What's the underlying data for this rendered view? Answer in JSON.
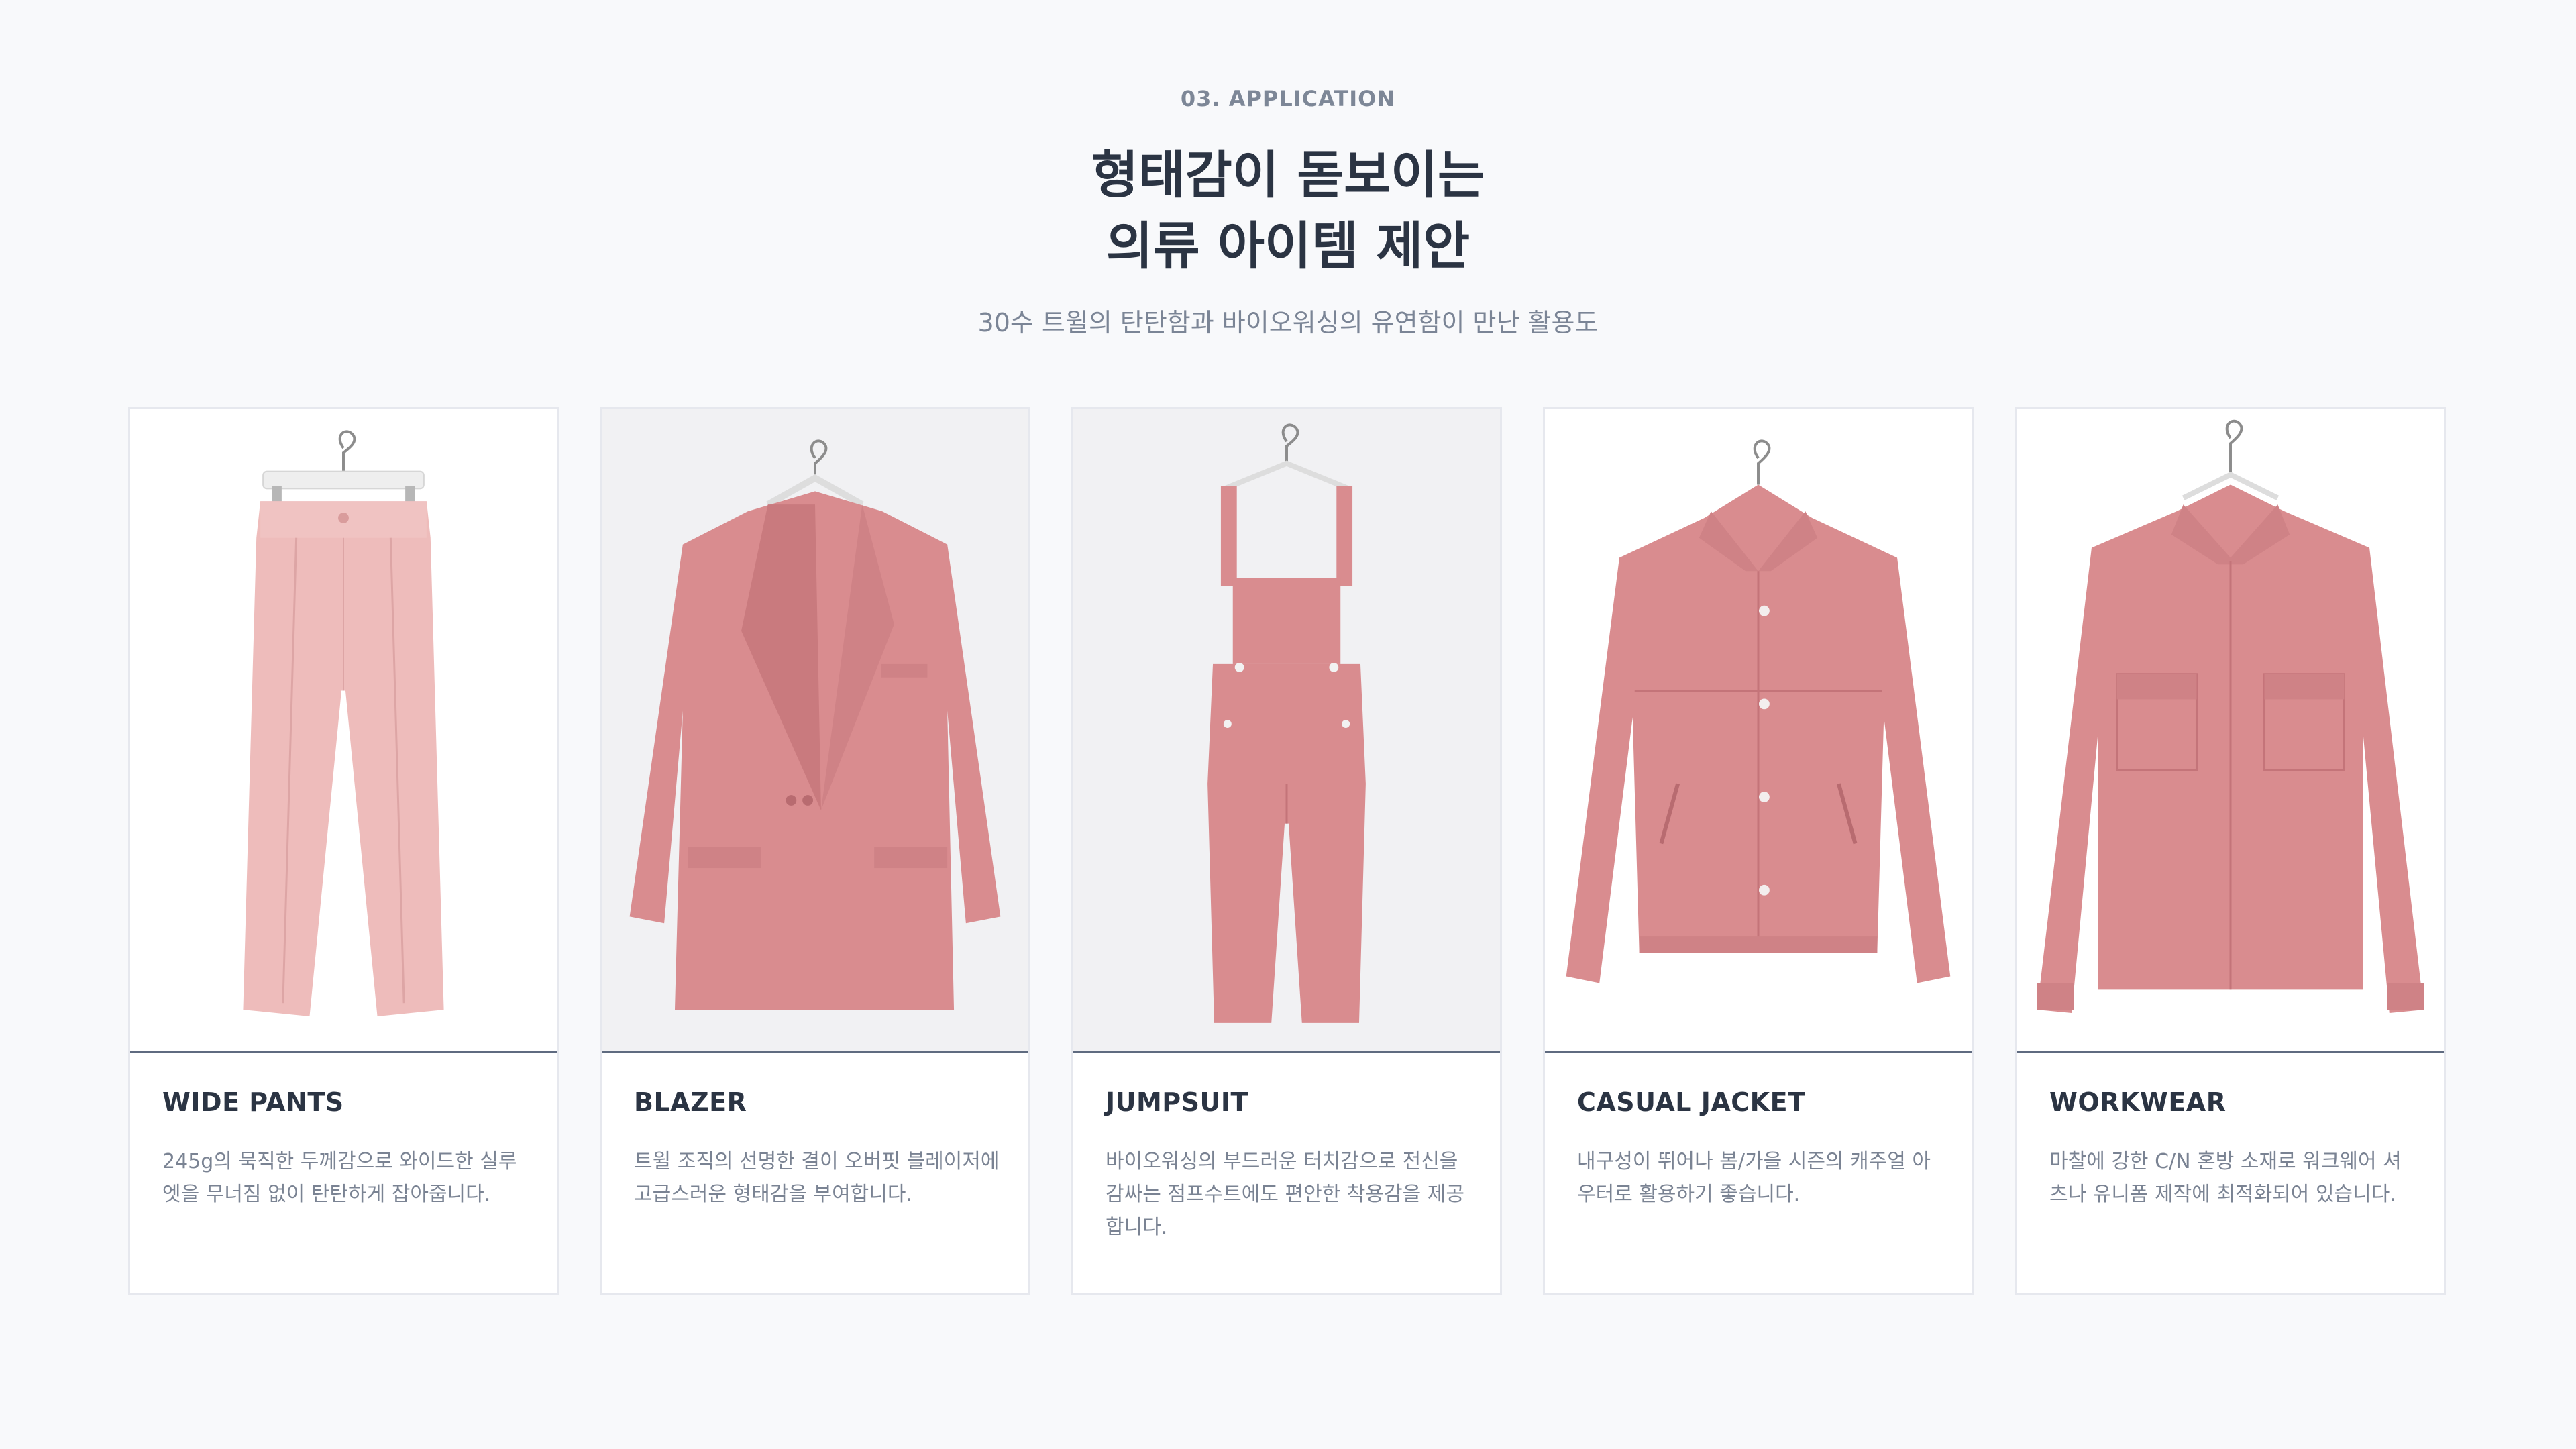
{
  "header": {
    "eyebrow": "03. APPLICATION",
    "title_line1": "형태감이 돋보이는",
    "title_line2": "의류 아이템 제안",
    "subtitle": "30수 트윌의 탄탄함과 바이오워싱의 유연함이 만난 활용도"
  },
  "colors": {
    "fabric_pink": "#d98c8f",
    "pants_pink": "#eebcbb",
    "heading": "#2b3443",
    "muted_text": "#7a8393",
    "divider": "#5f6b80"
  },
  "cards": [
    {
      "title": "WIDE PANTS",
      "desc": "245g의 묵직한 두께감으로 와이드한 실루엣을 무너짐 없이 탄탄하게 잡아줍니다.",
      "image_icon": "wide-pants-on-hanger"
    },
    {
      "title": "BLAZER",
      "desc": "트윌 조직의 선명한 결이 오버핏 블레이저에 고급스러운 형태감을 부여합니다.",
      "image_icon": "blazer-on-hanger"
    },
    {
      "title": "JUMPSUIT",
      "desc": "바이오워싱의 부드러운 터치감으로 전신을 감싸는 점프수트에도 편안한 착용감을 제공합니다.",
      "image_icon": "jumpsuit-on-hanger"
    },
    {
      "title": "CASUAL JACKET",
      "desc": "내구성이 뛰어나 봄/가을 시즌의 캐주얼 아우터로 활용하기 좋습니다.",
      "image_icon": "casual-jacket-on-hanger"
    },
    {
      "title": "WORKWEAR",
      "desc": "마찰에 강한 C/N 혼방 소재로 워크웨어 셔츠나 유니폼 제작에 최적화되어 있습니다.",
      "image_icon": "workwear-shirt-on-hanger"
    }
  ]
}
